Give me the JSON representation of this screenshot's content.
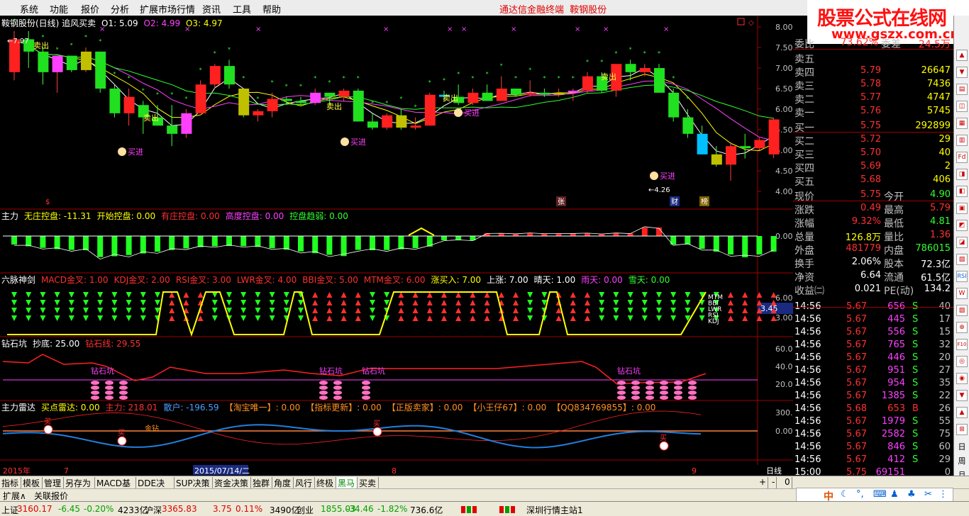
{
  "menu": [
    "系统",
    "功能",
    "报价",
    "分析",
    "扩展市场行情",
    "资讯",
    "工具",
    "帮助"
  ],
  "app_title": "通达信金融终端",
  "stock_title": "鞍钢股份",
  "watermark": {
    "line1": "股票公式在线网",
    "line2": "www.gszx.com.cn"
  },
  "chart": {
    "title": "鞍钢股份(日线) 追风买卖",
    "o1": "O1: 5.09",
    "o2": "O2: 4.99",
    "o3": "O3: 4.97",
    "high_mark": "7.97",
    "low_mark": "4.26",
    "y_ticks": [
      "8.00",
      "7.50",
      "7.00",
      "6.50",
      "6.00",
      "5.50",
      "5.00",
      "4.50",
      "4.00"
    ],
    "signal_buy": "买进",
    "signal_sell": "卖出",
    "event_labels": {
      "s": "$",
      "zhang": "张",
      "cai": "财",
      "bang": "榜"
    }
  },
  "panel_main": {
    "name": "主力",
    "items": [
      {
        "t": "无庄控盘: -11.31",
        "c": "#ffff00"
      },
      {
        "t": "开始控盘: 0.00",
        "c": "#ffff00"
      },
      {
        "t": "有庄控盘: 0.00",
        "c": "#ff3030"
      },
      {
        "t": "高度控盘: 0.00",
        "c": "#ff40ff"
      },
      {
        "t": "控盘趋弱: 0.00",
        "c": "#30ff30"
      }
    ],
    "ytick": "0.00"
  },
  "panel_six": {
    "name": "六脉神剑",
    "items": [
      {
        "t": "MACD金叉: 1.00",
        "c": "#ff3030"
      },
      {
        "t": "KDJ金叉: 2.00",
        "c": "#ff3030"
      },
      {
        "t": "RSI金叉: 3.00",
        "c": "#ff3030"
      },
      {
        "t": "LWR金叉: 4.00",
        "c": "#ff3030"
      },
      {
        "t": "BBI金叉: 5.00",
        "c": "#ff3030"
      },
      {
        "t": "MTM金叉: 6.00",
        "c": "#ff3030"
      },
      {
        "t": "涨买入: 7.00",
        "c": "#ffff00"
      },
      {
        "t": "上涨: 7.00",
        "c": "#ffffff"
      },
      {
        "t": "晴天: 1.00",
        "c": "#ffffff"
      },
      {
        "t": "雨天: 0.00",
        "c": "#ff40ff"
      },
      {
        "t": "雪天: 0.00",
        "c": "#30ff30"
      }
    ],
    "yticks": [
      "6.00",
      "3.00"
    ],
    "labels": [
      "MTM",
      "BBI",
      "LWR",
      "RSI",
      "KDJ"
    ],
    "cursor_value": "3.45"
  },
  "panel_diamond": {
    "name": "钻石坑",
    "items": [
      {
        "t": "抄底: 25.00",
        "c": "#ffffff"
      },
      {
        "t": "钻石线: 29.55",
        "c": "#ff3030"
      }
    ],
    "yticks": [
      "60.00",
      "40.00",
      "20.00"
    ],
    "label": "钻石坑"
  },
  "panel_radar": {
    "name": "主力雷达",
    "items": [
      {
        "t": "买点雷达: 0.00",
        "c": "#ffff00"
      },
      {
        "t": "主力: 218.01",
        "c": "#ff3030"
      },
      {
        "t": "散户: -196.59",
        "c": "#4aa0ff"
      },
      {
        "t": "【淘宝唯一】: 0.00",
        "c": "#ff9020"
      },
      {
        "t": "【指标更新】: 0.00",
        "c": "#ff9020"
      },
      {
        "t": "【正版卖家】: 0.00",
        "c": "#ff9020"
      },
      {
        "t": "【小王仔67】: 0.00",
        "c": "#ff9020"
      },
      {
        "t": "【QQ834769855】: 0.00",
        "c": "#ff9020"
      }
    ],
    "yticks": [
      "300.0",
      "0.00"
    ],
    "sig_buy": "买",
    "sig_diamond": "金钻"
  },
  "timeline": {
    "year": "2015年",
    "m7": "7",
    "date": "2015/07/14/二",
    "m8": "8",
    "m9": "9",
    "period": "日线"
  },
  "quote": {
    "weibi": {
      "label": "委比",
      "v": "73.62%",
      "label2": "委差",
      "v2": "24.5万"
    },
    "sell": [
      {
        "l": "卖五",
        "p": "",
        "v": ""
      },
      {
        "l": "卖四",
        "p": "5.79",
        "v": "26647"
      },
      {
        "l": "卖三",
        "p": "5.78",
        "v": "7436"
      },
      {
        "l": "卖二",
        "p": "5.77",
        "v": "4747"
      },
      {
        "l": "卖一",
        "p": "5.76",
        "v": "5745"
      }
    ],
    "buy": [
      {
        "l": "买一",
        "p": "5.75",
        "v": "292899"
      },
      {
        "l": "买二",
        "p": "5.72",
        "v": "29"
      },
      {
        "l": "买三",
        "p": "5.70",
        "v": "40"
      },
      {
        "l": "买四",
        "p": "5.69",
        "v": "2"
      },
      {
        "l": "买五",
        "p": "5.68",
        "v": "406"
      }
    ],
    "stats": [
      {
        "l": "现价",
        "v": "5.75",
        "c": "#ff3030",
        "l2": "今开",
        "v2": "4.90",
        "c2": "#30ff30"
      },
      {
        "l": "涨跌",
        "v": "0.49",
        "c": "#ff3030",
        "l2": "最高",
        "v2": "5.79",
        "c2": "#ff3030"
      },
      {
        "l": "涨幅",
        "v": "9.32%",
        "c": "#ff3030",
        "l2": "最低",
        "v2": "4.81",
        "c2": "#30ff30"
      },
      {
        "l": "总量",
        "v": "126.8万",
        "c": "#ffff00",
        "l2": "量比",
        "v2": "1.36",
        "c2": "#ff3030"
      },
      {
        "l": "外盘",
        "v": "481779",
        "c": "#ff3030",
        "l2": "内盘",
        "v2": "786015",
        "c2": "#30ff30"
      },
      {
        "l": "换手",
        "v": "2.06%",
        "c": "#ffffff",
        "l2": "股本",
        "v2": "72.3亿",
        "c2": "#ffffff"
      },
      {
        "l": "净资",
        "v": "6.64",
        "c": "#ffffff",
        "l2": "流通",
        "v2": "61.5亿",
        "c2": "#ffffff"
      },
      {
        "l": "收益㈡",
        "v": "0.021",
        "c": "#ffffff",
        "l2": "PE(动)",
        "v2": "134.2",
        "c2": "#ffffff"
      }
    ],
    "ticks": [
      {
        "t": "14:56",
        "p": "5.67",
        "v": "656",
        "s": "S",
        "n": "40"
      },
      {
        "t": "14:56",
        "p": "5.67",
        "v": "445",
        "s": "S",
        "n": "17"
      },
      {
        "t": "14:56",
        "p": "5.67",
        "v": "556",
        "s": "S",
        "n": "15"
      },
      {
        "t": "14:56",
        "p": "5.67",
        "v": "765",
        "s": "S",
        "n": "32"
      },
      {
        "t": "14:56",
        "p": "5.67",
        "v": "446",
        "s": "S",
        "n": "20"
      },
      {
        "t": "14:56",
        "p": "5.67",
        "v": "951",
        "s": "S",
        "n": "27"
      },
      {
        "t": "14:56",
        "p": "5.67",
        "v": "954",
        "s": "S",
        "n": "35"
      },
      {
        "t": "14:56",
        "p": "5.67",
        "v": "1385",
        "s": "S",
        "n": "22"
      },
      {
        "t": "14:56",
        "p": "5.68",
        "v": "653",
        "s": "B",
        "n": "26"
      },
      {
        "t": "14:56",
        "p": "5.67",
        "v": "1979",
        "s": "S",
        "n": "55"
      },
      {
        "t": "14:56",
        "p": "5.67",
        "v": "2582",
        "s": "S",
        "n": "75"
      },
      {
        "t": "14:56",
        "p": "5.67",
        "v": "846",
        "s": "S",
        "n": "60"
      },
      {
        "t": "14:56",
        "p": "5.67",
        "v": "412",
        "s": "S",
        "n": "29"
      },
      {
        "t": "15:00",
        "p": "5.75",
        "v": "69151",
        "s": "",
        "n": "0"
      }
    ]
  },
  "tabs": [
    "指标",
    "模板",
    "管理",
    "另存为",
    "MACD基本",
    "DDE决策",
    "SUP决策",
    "资金决策",
    "独群",
    "角度",
    "风行",
    "终极",
    "黑马",
    "买卖"
  ],
  "bar2": [
    "扩展∧",
    "关联报价"
  ],
  "status": [
    {
      "t": "上证",
      "c": "#000"
    },
    {
      "t": "3160.17",
      "c": "#e00000"
    },
    {
      "t": "-6.45",
      "c": "#00a000"
    },
    {
      "t": "-0.20%",
      "c": "#00a000"
    },
    {
      "t": "4233亿",
      "c": "#000"
    },
    {
      "t": "沪深",
      "c": "#000"
    },
    {
      "t": "3365.83",
      "c": "#e00000"
    },
    {
      "t": "3.75",
      "c": "#e00000"
    },
    {
      "t": "0.11%",
      "c": "#e00000"
    },
    {
      "t": "3490亿",
      "c": "#000"
    },
    {
      "t": "创业",
      "c": "#000"
    },
    {
      "t": "1855.03",
      "c": "#00a000"
    },
    {
      "t": "-34.46",
      "c": "#00a000"
    },
    {
      "t": "-1.82%",
      "c": "#00a000"
    },
    {
      "t": "736.6亿",
      "c": "#000"
    },
    {
      "t": "深圳行情主站1",
      "c": "#000"
    }
  ],
  "ime": "中",
  "side_icons": [
    "RSI",
    "Fd",
    "W",
    "F10"
  ],
  "side_day_labels": [
    "日",
    "周",
    "月"
  ],
  "ohlc": [
    [
      6.9,
      7.9,
      6.7,
      7.7
    ],
    [
      7.7,
      7.9,
      7.0,
      7.4
    ],
    [
      7.4,
      7.5,
      6.6,
      6.9
    ],
    [
      6.9,
      7.2,
      6.4,
      7.3
    ],
    [
      7.3,
      7.3,
      6.9,
      6.95
    ],
    [
      6.95,
      7.5,
      6.9,
      7.4
    ],
    [
      7.4,
      7.4,
      6.4,
      6.5
    ],
    [
      6.5,
      6.6,
      5.8,
      5.9
    ],
    [
      5.9,
      6.5,
      5.6,
      6.3
    ],
    [
      6.1,
      6.2,
      5.4,
      5.8
    ],
    [
      5.8,
      6.1,
      5.6,
      5.6
    ],
    [
      5.6,
      6.1,
      5.1,
      5.4
    ],
    [
      5.4,
      6.0,
      5.3,
      5.9
    ],
    [
      5.9,
      6.7,
      5.9,
      6.6
    ],
    [
      6.6,
      7.1,
      6.5,
      7.05
    ],
    [
      7.05,
      7.2,
      6.5,
      6.6
    ],
    [
      6.5,
      6.5,
      5.8,
      5.85
    ],
    [
      5.85,
      6.0,
      5.7,
      5.95
    ],
    [
      5.95,
      6.4,
      5.8,
      6.25
    ],
    [
      6.25,
      6.3,
      6.1,
      6.2
    ],
    [
      6.2,
      6.3,
      6.1,
      6.15
    ],
    [
      6.15,
      6.5,
      6.1,
      6.4
    ],
    [
      6.4,
      6.4,
      6.1,
      6.3
    ],
    [
      6.3,
      6.5,
      6.2,
      6.45
    ],
    [
      6.45,
      6.5,
      5.7,
      5.7
    ],
    [
      5.7,
      5.9,
      5.5,
      5.55
    ],
    [
      5.55,
      5.9,
      5.5,
      5.85
    ],
    [
      5.85,
      6.0,
      5.5,
      5.55
    ],
    [
      5.55,
      5.8,
      5.5,
      5.6
    ],
    [
      5.6,
      6.4,
      5.6,
      6.35
    ],
    [
      6.35,
      6.45,
      6.2,
      6.3
    ],
    [
      6.3,
      6.6,
      6.1,
      6.15
    ],
    [
      6.15,
      6.5,
      6.1,
      6.4
    ],
    [
      6.4,
      6.6,
      6.2,
      6.2
    ],
    [
      6.2,
      6.8,
      6.2,
      6.5
    ],
    [
      6.5,
      6.5,
      6.3,
      6.35
    ],
    [
      6.35,
      6.7,
      6.3,
      6.4
    ],
    [
      6.4,
      6.5,
      6.3,
      6.35
    ],
    [
      6.35,
      6.5,
      6.3,
      6.4
    ],
    [
      6.4,
      6.5,
      6.2,
      6.45
    ],
    [
      6.45,
      6.9,
      6.4,
      6.8
    ],
    [
      6.8,
      6.9,
      6.4,
      6.45
    ],
    [
      6.45,
      7.1,
      6.3,
      7.1
    ],
    [
      7.1,
      7.2,
      6.7,
      6.9
    ],
    [
      6.9,
      7.1,
      6.8,
      7.0
    ],
    [
      7.0,
      7.1,
      6.4,
      6.4
    ],
    [
      6.4,
      6.5,
      5.7,
      5.8
    ],
    [
      5.8,
      6.0,
      5.3,
      5.4
    ],
    [
      5.4,
      5.6,
      4.9,
      4.9
    ],
    [
      4.9,
      5.1,
      4.6,
      4.65
    ],
    [
      4.65,
      5.2,
      4.26,
      5.1
    ],
    [
      5.1,
      5.4,
      4.8,
      5.05
    ],
    [
      5.05,
      5.3,
      5.0,
      5.25
    ],
    [
      4.9,
      5.79,
      4.81,
      5.75
    ]
  ]
}
